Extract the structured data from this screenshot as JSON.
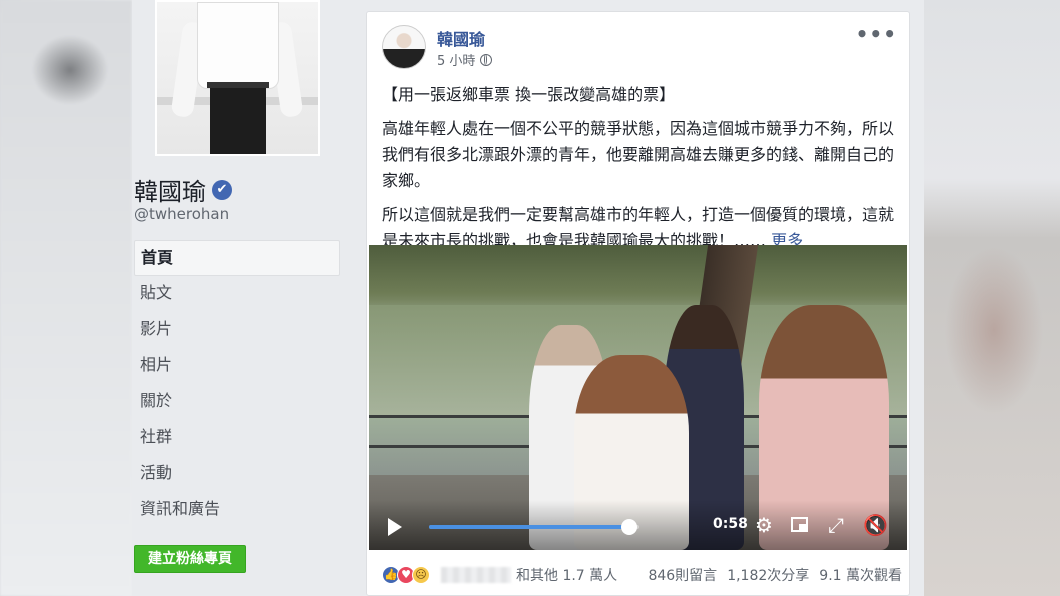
{
  "sidebar": {
    "page_name": "韓國瑜",
    "handle": "@twherohan",
    "nav_items": [
      "首頁",
      "貼文",
      "影片",
      "相片",
      "關於",
      "社群",
      "活動",
      "資訊和廣告"
    ],
    "create_page_label": "建立粉絲專頁"
  },
  "post": {
    "author": "韓國瑜",
    "time": "5 小時",
    "headline": "【用一張返鄉車票 換一張改變高雄的票】",
    "paragraph1": "高雄年輕人處在一個不公平的競爭狀態，因為這個城市競爭力不夠，所以我們有很多北漂跟外漂的青年，他要離開高雄去賺更多的錢、離開自己的家鄉。",
    "paragraph2": "所以這個就是我們一定要幫高雄市的年輕人，打造一個優質的環境，這就是未來市長的挑戰，也會是我韓國瑜最大的挑戰！……",
    "see_more": "更多"
  },
  "video": {
    "current_time": "0:58",
    "progress": 0.95
  },
  "footer": {
    "others_text": "和其他 1.7 萬人",
    "comments": "846則留言",
    "shares": "1,182次分享",
    "views": "9.1 萬次觀看"
  },
  "colors": {
    "link_blue": "#385898",
    "accent_green": "#42b72a",
    "progress_blue": "#4a90e2"
  }
}
